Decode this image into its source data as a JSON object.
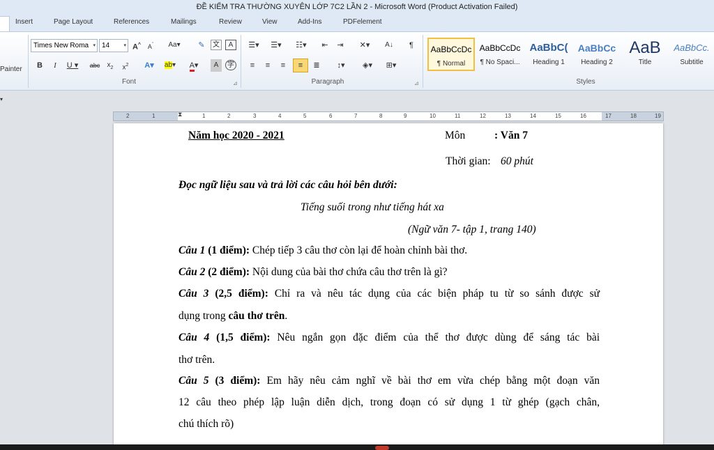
{
  "window": {
    "title": "ĐỀ KIỂM TRA THƯỜNG XUYÊN LỚP 7C2 LẦN 2 - Microsoft Word (Product Activation Failed)"
  },
  "tabs": [
    "Insert",
    "Page Layout",
    "References",
    "Mailings",
    "Review",
    "View",
    "Add-Ins",
    "PDFelement"
  ],
  "ribbon": {
    "clipboard_label": "Painter",
    "font": {
      "name": "Times New Roma",
      "size": "14",
      "group_label": "Font"
    },
    "paragraph": {
      "group_label": "Paragraph"
    },
    "styles": {
      "group_label": "Styles",
      "items": [
        {
          "preview": "AaBbCcDc",
          "name": "¶ Normal"
        },
        {
          "preview": "AaBbCcDc",
          "name": "¶ No Spaci..."
        },
        {
          "preview": "AaBbC(",
          "name": "Heading 1"
        },
        {
          "preview": "AaBbCc",
          "name": "Heading 2"
        },
        {
          "preview": "AaB",
          "name": "Title"
        },
        {
          "preview": "AaBbCc.",
          "name": "Subtitle"
        }
      ]
    }
  },
  "ruler": {
    "ticks": [
      "2",
      "1",
      "1",
      "2",
      "3",
      "4",
      "5",
      "6",
      "7",
      "8",
      "9",
      "10",
      "11",
      "12",
      "13",
      "14",
      "15",
      "16",
      "17",
      "18",
      "19"
    ]
  },
  "document": {
    "year": "Năm học 2020 - 2021",
    "subject_label": "Môn",
    "subject_value": ": Văn 7",
    "time_label": "Thời gian:",
    "time_value": "60 phút",
    "instruction": "Đọc ngữ liệu sau và trả lời các câu hỏi bên dưới:",
    "poem_title": "Tiếng suối trong như tiếng hát xa",
    "source": "(Ngữ văn 7- tập 1,  trang 140)",
    "q1_head": "Câu 1",
    "q1_points": "(1 điểm):",
    "q1_text": "Chép tiếp 3 câu thơ còn lại để hoàn chỉnh bài thơ.",
    "q2_head": "Câu 2",
    "q2_points": "(2 điểm):",
    "q2_text": "Nội dung của bài thơ chứa câu thơ trên là gì?",
    "q3_head": "Câu 3",
    "q3_points": "(2,5 điểm):",
    "q3_text": "Chỉ ra và nêu tác dụng của các biện pháp tu từ so sánh được sử",
    "q3_text2a": "dụng trong",
    "q3_text2b": "câu thơ trên",
    "q3_text2c": ".",
    "q4_head": "Câu 4",
    "q4_points": "(1,5 điểm):",
    "q4_text": "Nêu ngắn gọn đặc điểm của thể thơ được dùng để sáng tác bài",
    "q4_text2": "thơ trên.",
    "q5_head": "Câu 5",
    "q5_points": "(3 điểm):",
    "q5_text": "Em hãy nêu cảm nghĩ về bài thơ em vừa chép bằng một đoạn văn",
    "q5_text2": "12 câu theo phép lập luận diễn dịch, trong đoạn có sử dụng 1 từ ghép (gạch chân,",
    "q5_text3": "chú thích rõ)"
  }
}
